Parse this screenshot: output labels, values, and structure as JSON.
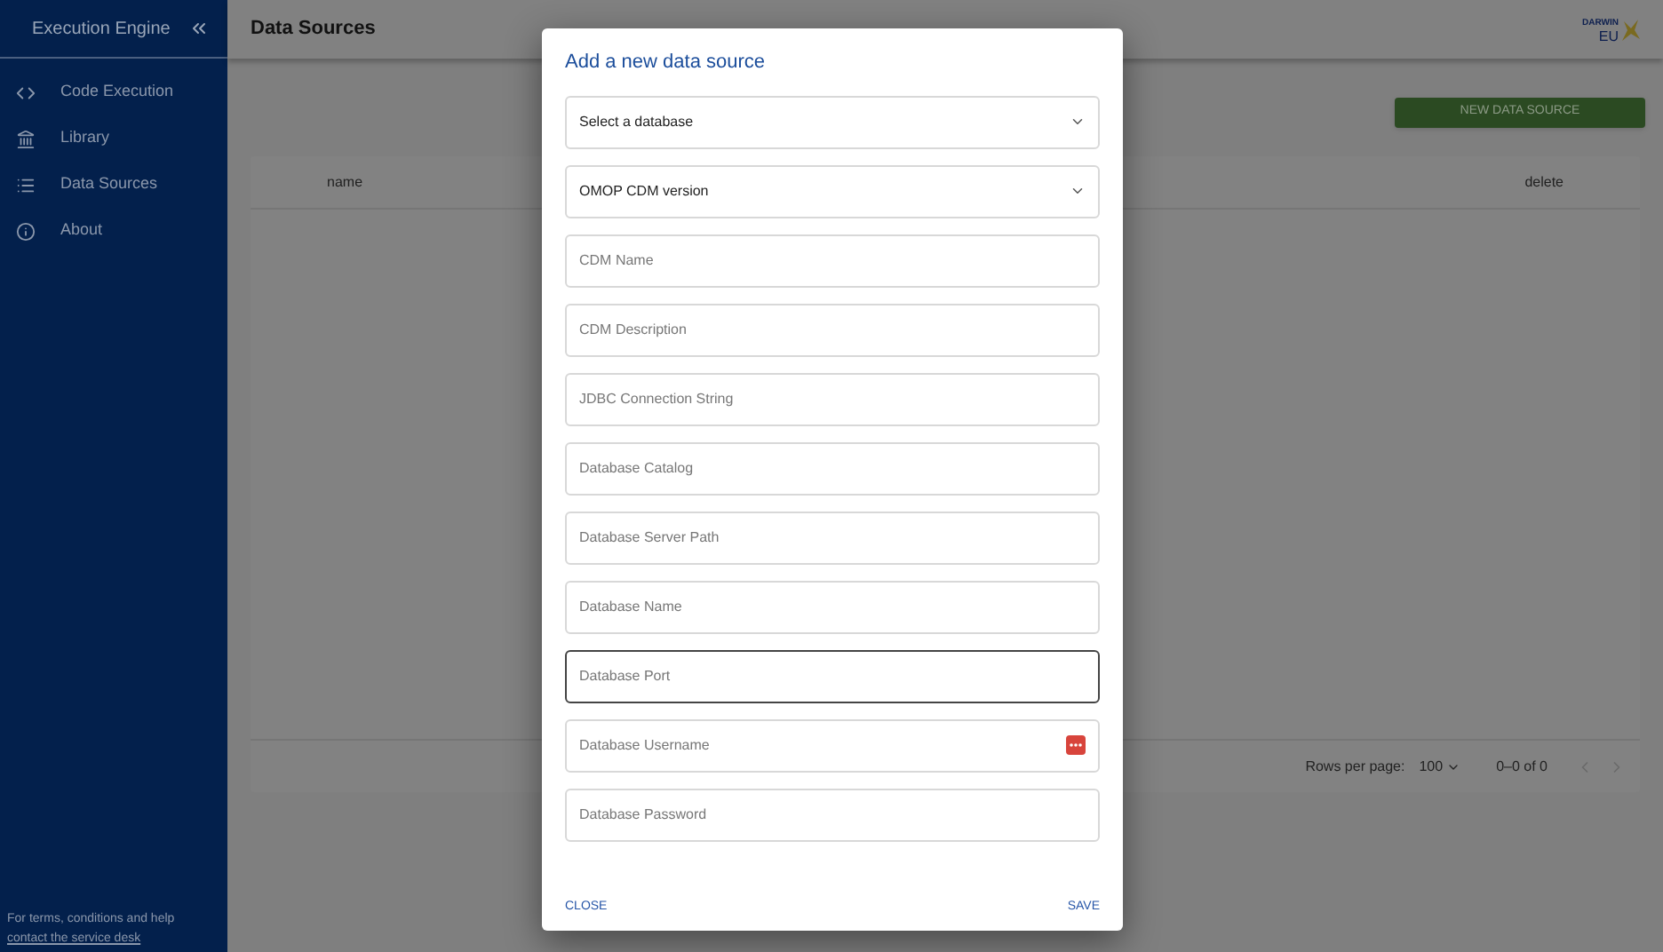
{
  "sidebar": {
    "title": "Execution Engine",
    "items": [
      {
        "label": "Code Execution",
        "kind": "code",
        "selected": false
      },
      {
        "label": "Library",
        "kind": "library",
        "selected": false
      },
      {
        "label": "Data Sources",
        "kind": "list",
        "selected": false
      },
      {
        "label": "About",
        "kind": "info",
        "selected": false
      }
    ],
    "footer": {
      "text": "For terms, conditions and help",
      "link": "contact the service desk"
    }
  },
  "header": {
    "title": "Data Sources",
    "logo": {
      "top": "DARWIN",
      "bottom": "EU"
    }
  },
  "new_button": "NEW DATA SOURCE",
  "table": {
    "columns": [
      "name",
      "delete"
    ]
  },
  "pagination": {
    "rows_label": "Rows per page:",
    "rows_value": "100",
    "range": "0–0 of 0"
  },
  "dialog": {
    "title": "Add a new data source",
    "fields": [
      {
        "kind": "select",
        "placeholder": "Select a database",
        "focused": false
      },
      {
        "kind": "select",
        "placeholder": "OMOP CDM version",
        "focused": false
      },
      {
        "kind": "text",
        "placeholder": "CDM Name",
        "focused": false
      },
      {
        "kind": "text",
        "placeholder": "CDM Description",
        "focused": false
      },
      {
        "kind": "text",
        "placeholder": "JDBC Connection String",
        "focused": false
      },
      {
        "kind": "text",
        "placeholder": "Database Catalog",
        "focused": false
      },
      {
        "kind": "text",
        "placeholder": "Database Server Path",
        "focused": false
      },
      {
        "kind": "text",
        "placeholder": "Database Name",
        "focused": false
      },
      {
        "kind": "text",
        "placeholder": "Database Port",
        "focused": true
      },
      {
        "kind": "login",
        "placeholder": "Database Username",
        "focused": false
      },
      {
        "kind": "text",
        "placeholder": "Database Password",
        "focused": false
      }
    ],
    "actions": [
      "CLOSE",
      "SAVE"
    ]
  }
}
